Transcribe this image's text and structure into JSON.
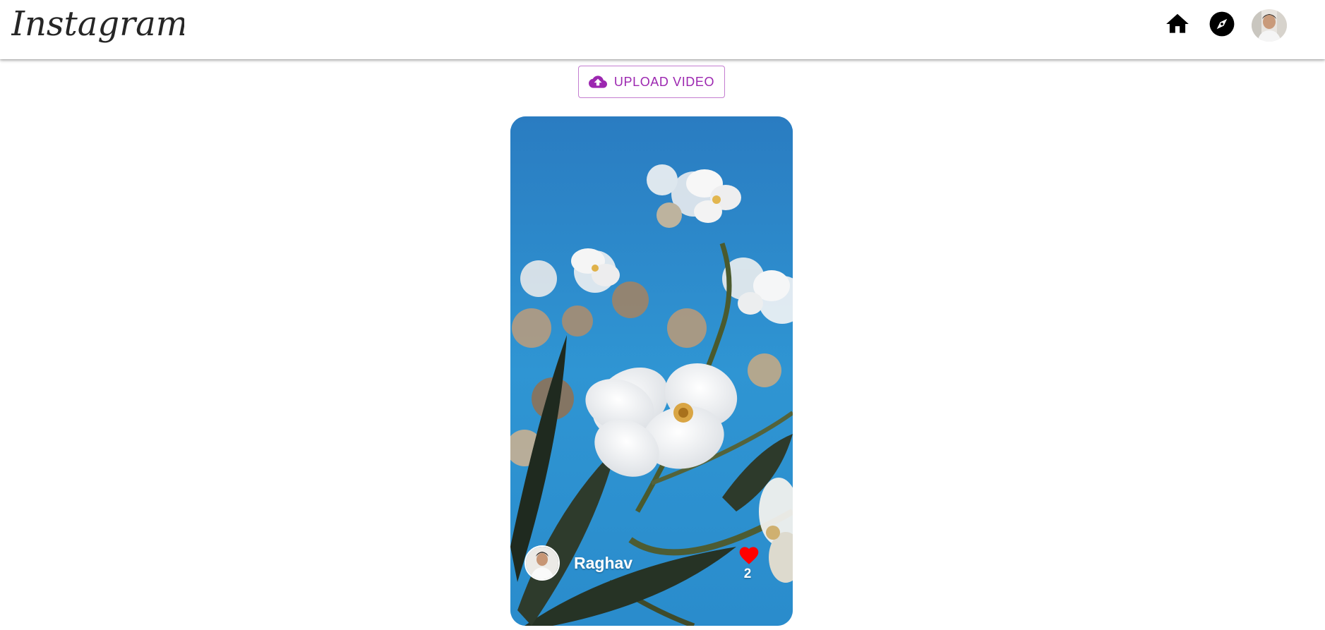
{
  "app": {
    "brand_name": "Instagram"
  },
  "navbar": {
    "icons": [
      "home-icon",
      "explore-compass-icon"
    ],
    "profile_avatar": "profile-avatar"
  },
  "upload": {
    "label": "UPLOAD VIDEO",
    "icon": "cloud-upload-icon",
    "color": "#9c27b0"
  },
  "reel": {
    "username": "Raghav",
    "likes": "2",
    "like_icon": "heart-icon",
    "like_color": "#ff0000"
  }
}
